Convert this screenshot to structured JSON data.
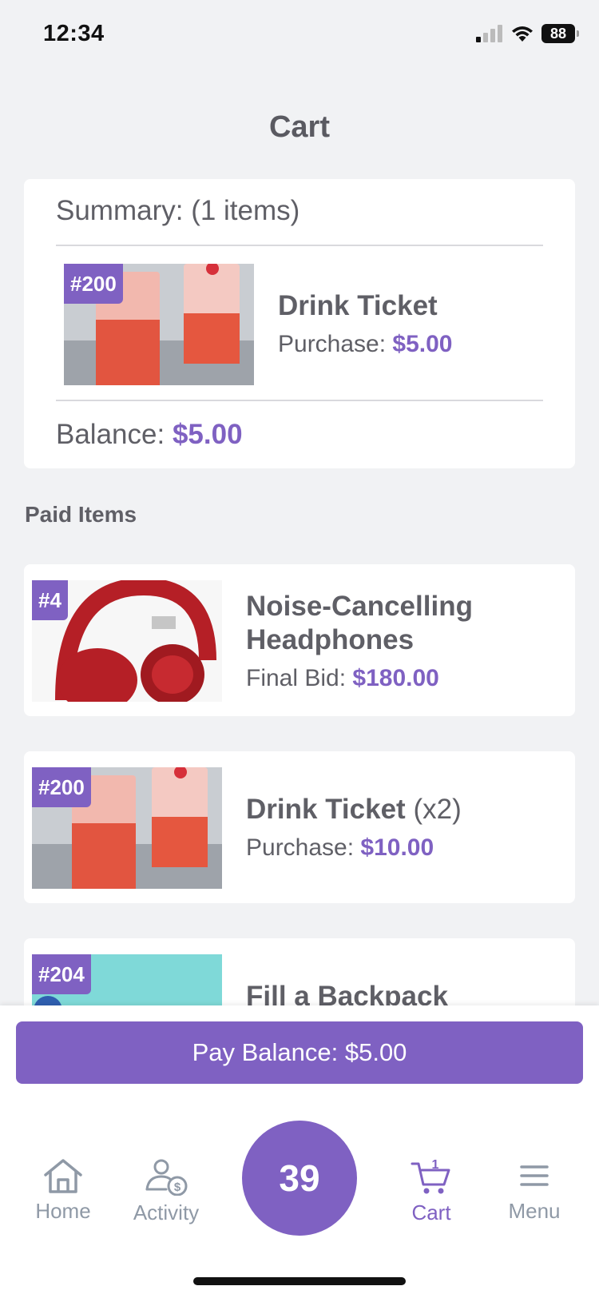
{
  "status_bar": {
    "time": "12:34",
    "battery": "88"
  },
  "page": {
    "title": "Cart"
  },
  "summary": {
    "header": "Summary: (1 items)",
    "item": {
      "badge": "#200",
      "title": "Drink Ticket",
      "price_label": "Purchase:",
      "price": "$5.00"
    },
    "balance_label": "Balance:",
    "balance_value": "$5.00"
  },
  "paid_items": {
    "label": "Paid Items",
    "items": [
      {
        "badge": "#4",
        "title_line1": "Noise-Cancelling",
        "title_line2": "Headphones",
        "price_label": "Final Bid:",
        "price": "$180.00"
      },
      {
        "badge": "#200",
        "title": "Drink Ticket",
        "qty": "(x2)",
        "price_label": "Purchase:",
        "price": "$10.00"
      },
      {
        "badge": "#204",
        "title": "Fill a Backpack"
      }
    ]
  },
  "pay_button": {
    "label": "Pay Balance: $5.00"
  },
  "tabbar": {
    "home": "Home",
    "activity": "Activity",
    "center_number": "39",
    "cart": "Cart",
    "cart_count": "1",
    "menu": "Menu"
  },
  "colors": {
    "accent": "#7f61c2",
    "text": "#5f5f66",
    "background": "#f1f2f4",
    "tab_inactive": "#8f99a6"
  },
  "icons": [
    "signal-icon",
    "wifi-icon",
    "battery-icon",
    "home-icon",
    "activity-icon",
    "cart-icon",
    "menu-icon"
  ]
}
